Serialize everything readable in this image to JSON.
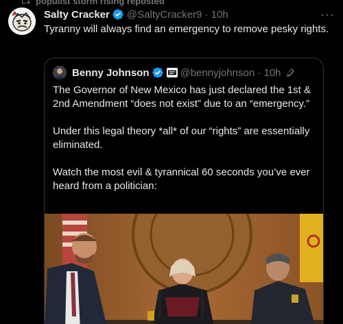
{
  "repost": {
    "text": "populist storm rising reposted"
  },
  "tweet": {
    "name": "Salty Cracker",
    "handle": "@SaltyCracker9",
    "time": "10h",
    "text": "Tyranny will always find an emergency to remove pesky rights."
  },
  "quote": {
    "name": "Benny Johnson",
    "handle": "@bennyjohnson",
    "time": "10h",
    "paragraphs": [
      "The Governor of New Mexico has just declared the 1st & 2nd Amendment “does not exist” due to an “emergency.”",
      "Under this legal theory *all* of our “rights” are essentially eliminated.",
      "Watch the most evil & tyrannical 60 seconds you’ve ever heard from a politician:"
    ]
  },
  "icons": {
    "repost": "repost-icon",
    "verified": "verified-badge-icon",
    "more": "more-options-icon",
    "edited": "edited-pencil-icon"
  },
  "colors": {
    "background": "#000000",
    "text": "#e7e9ea",
    "muted": "#71767b",
    "verified": "#1d9bf0",
    "border": "#2f3336"
  }
}
